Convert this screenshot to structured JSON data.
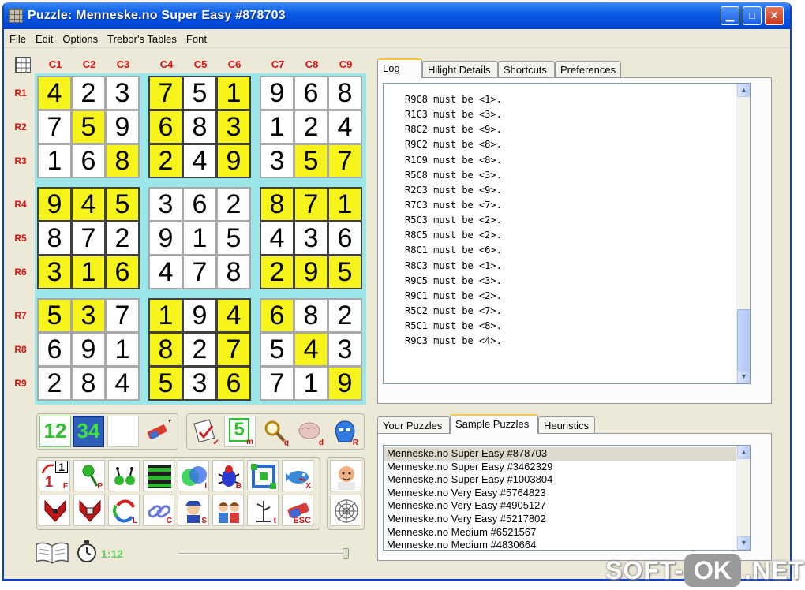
{
  "window": {
    "title": "Puzzle: Menneske.no Super Easy #878703"
  },
  "menu": [
    "File",
    "Edit",
    "Options",
    "Trebor's Tables",
    "Font"
  ],
  "board": {
    "columns": [
      "C1",
      "C2",
      "C3",
      "C4",
      "C5",
      "C6",
      "C7",
      "C8",
      "C9"
    ],
    "rows": [
      "R1",
      "R2",
      "R3",
      "R4",
      "R5",
      "R6",
      "R7",
      "R8",
      "R9"
    ],
    "cells": [
      [
        "4",
        "2",
        "3",
        "7",
        "5",
        "1",
        "9",
        "6",
        "8"
      ],
      [
        "7",
        "5",
        "9",
        "6",
        "8",
        "3",
        "1",
        "2",
        "4"
      ],
      [
        "1",
        "6",
        "8",
        "2",
        "4",
        "9",
        "3",
        "5",
        "7"
      ],
      [
        "9",
        "4",
        "5",
        "3",
        "6",
        "2",
        "8",
        "7",
        "1"
      ],
      [
        "8",
        "7",
        "2",
        "9",
        "1",
        "5",
        "4",
        "3",
        "6"
      ],
      [
        "3",
        "1",
        "6",
        "4",
        "7",
        "8",
        "2",
        "9",
        "5"
      ],
      [
        "5",
        "3",
        "7",
        "1",
        "9",
        "4",
        "6",
        "8",
        "2"
      ],
      [
        "6",
        "9",
        "1",
        "8",
        "2",
        "7",
        "5",
        "4",
        "3"
      ],
      [
        "2",
        "8",
        "4",
        "5",
        "3",
        "6",
        "7",
        "1",
        "9"
      ]
    ],
    "highlighted": [
      [
        1,
        0,
        0,
        1,
        0,
        1,
        0,
        0,
        0
      ],
      [
        0,
        1,
        0,
        1,
        0,
        1,
        0,
        0,
        0
      ],
      [
        0,
        0,
        1,
        1,
        0,
        1,
        0,
        1,
        1
      ],
      [
        1,
        1,
        1,
        0,
        0,
        0,
        1,
        1,
        1
      ],
      [
        0,
        0,
        0,
        0,
        0,
        0,
        0,
        0,
        0
      ],
      [
        1,
        1,
        1,
        0,
        0,
        0,
        1,
        1,
        1
      ],
      [
        1,
        1,
        0,
        1,
        0,
        1,
        1,
        0,
        0
      ],
      [
        0,
        0,
        0,
        1,
        0,
        1,
        0,
        1,
        0
      ],
      [
        0,
        0,
        0,
        1,
        0,
        1,
        0,
        0,
        1
      ]
    ],
    "highlight_color": "#f7f41c"
  },
  "tabs_top": [
    {
      "label": "Log",
      "active": true
    },
    {
      "label": "Hilight Details",
      "active": false
    },
    {
      "label": "Shortcuts",
      "active": false
    },
    {
      "label": "Preferences",
      "active": false
    }
  ],
  "log": [
    "R9C8 must be <1>.",
    "R1C3 must be <3>.",
    "R8C2 must be <9>.",
    "R9C2 must be <8>.",
    "R1C9 must be <8>.",
    "R5C8 must be <3>.",
    "R2C3 must be <9>.",
    "R7C3 must be <7>.",
    "R5C3 must be <2>.",
    "R8C5 must be <2>.",
    "R8C1 must be <6>.",
    "R8C3 must be <1>.",
    "R9C5 must be <3>.",
    "R9C1 must be <2>.",
    "R5C2 must be <7>.",
    "R5C1 must be <8>.",
    "R9C3 must be <4>."
  ],
  "tabs_bottom": [
    {
      "label": "Your Puzzles",
      "active": false
    },
    {
      "label": "Sample Puzzles",
      "active": true
    },
    {
      "label": "Heuristics",
      "active": false
    }
  ],
  "puzzles": [
    {
      "label": "Menneske.no Super Easy #878703",
      "selected": true
    },
    {
      "label": "Menneske.no Super Easy #3462329",
      "selected": false
    },
    {
      "label": "Menneske.no Super Easy #1003804",
      "selected": false
    },
    {
      "label": "Menneske.no Very Easy #5764823",
      "selected": false
    },
    {
      "label": "Menneske.no Very Easy #4905127",
      "selected": false
    },
    {
      "label": "Menneske.no Very Easy #5217802",
      "selected": false
    },
    {
      "label": "Menneske.no Medium #6521567",
      "selected": false
    },
    {
      "label": "Menneske.no Medium #4830664",
      "selected": false
    }
  ],
  "toolbar": {
    "mode_small_digits": "12",
    "mode_large_digits": "34",
    "shortcut_letters": {
      "check": "✓",
      "m": "m",
      "g": "g",
      "d": "d",
      "R": "R",
      "F": "F",
      "P": "P",
      "B": "B",
      "X": "X",
      "I": "I",
      "L": "L",
      "C": "C",
      "S": "S",
      "t": "t",
      "ESC": "ESC"
    },
    "hint_digit": "5",
    "forcing_top": "1",
    "forcing_bottom": "1"
  },
  "status": {
    "timer": "1:12"
  },
  "watermark": {
    "left": "SOFT-",
    "middle": "OK",
    "right": ".NET"
  }
}
